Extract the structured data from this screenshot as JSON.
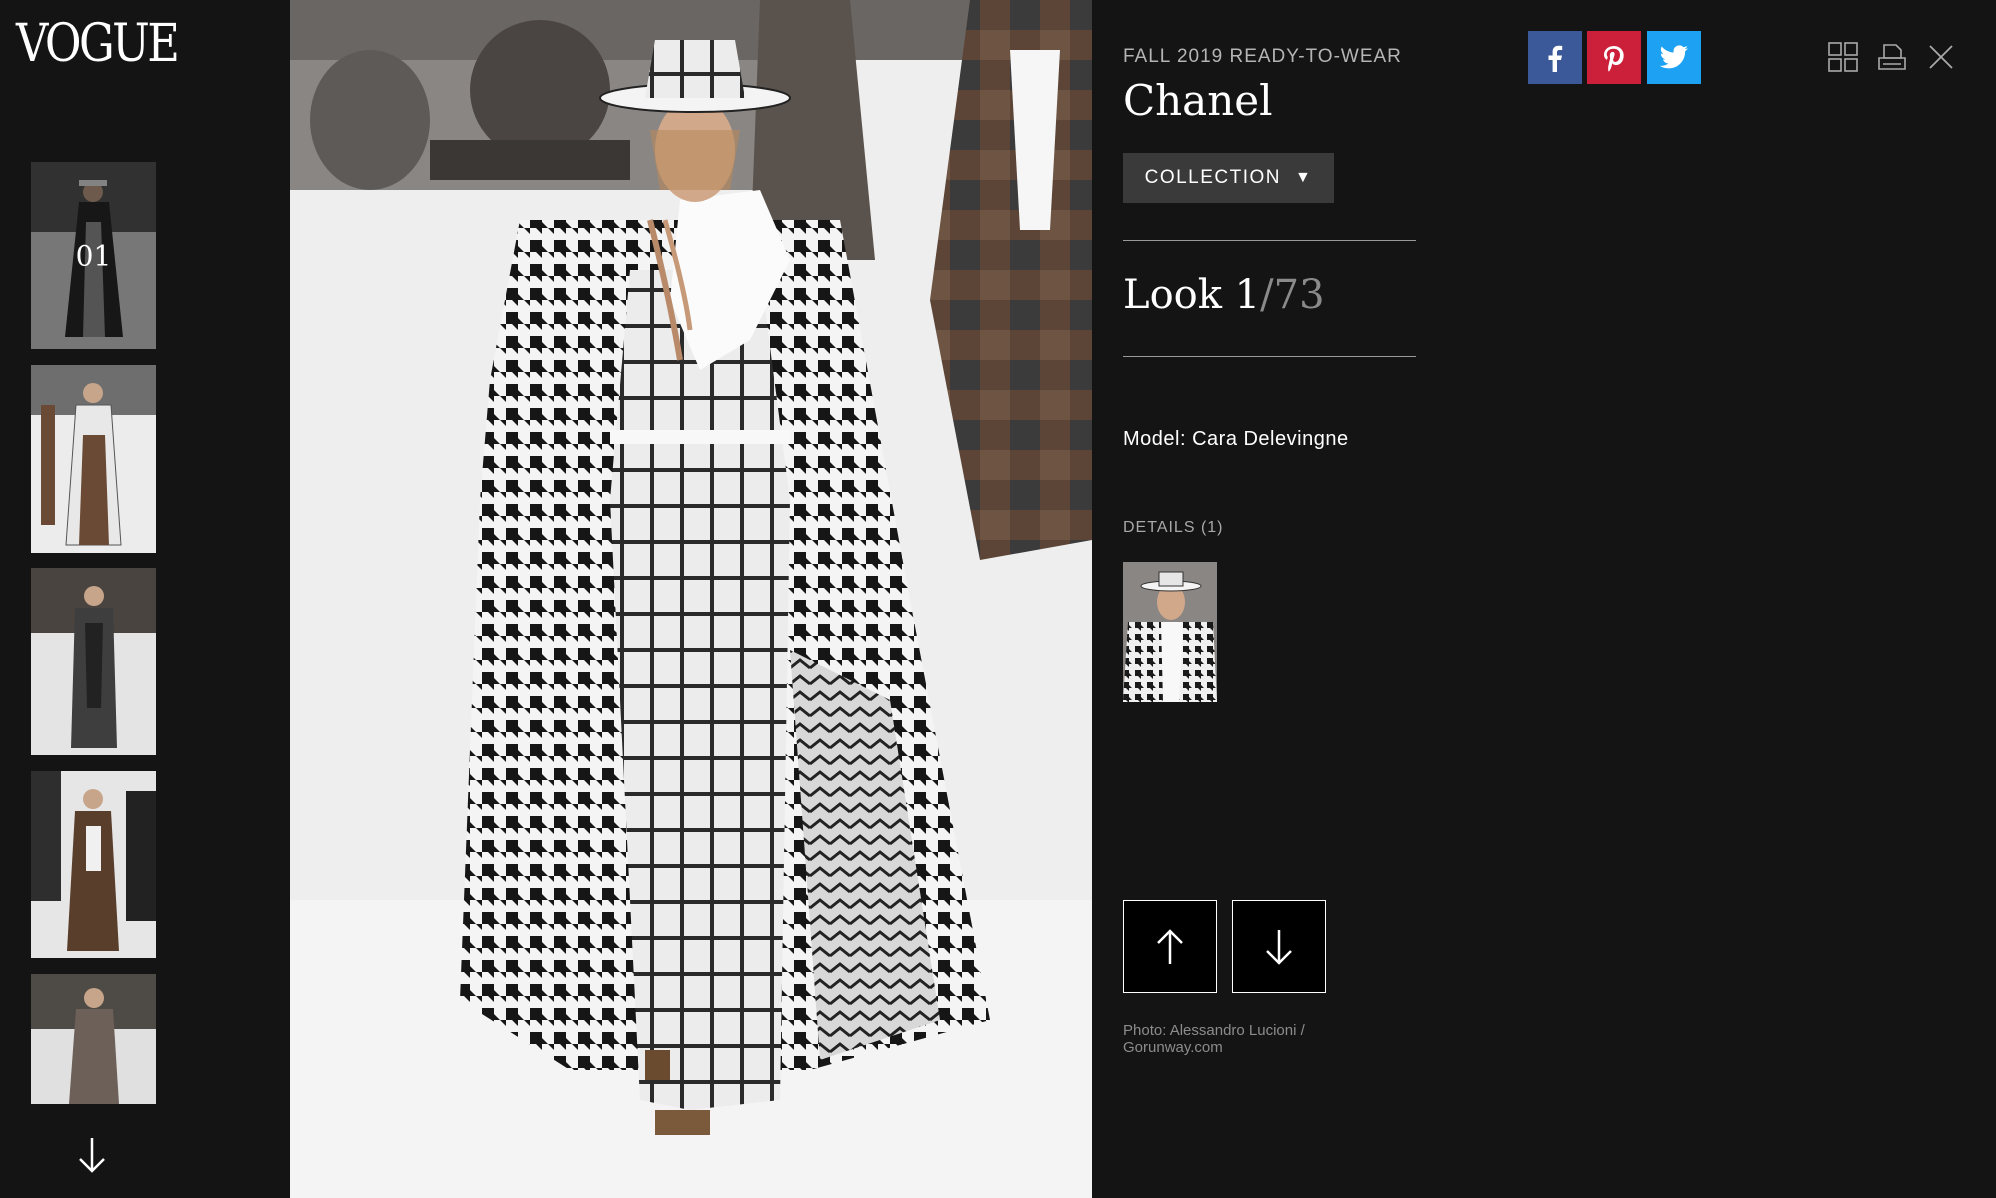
{
  "brand": {
    "logo_text": "VOGUE"
  },
  "sidebar": {
    "thumbnails": [
      {
        "label": "01",
        "active": true
      },
      {
        "label": "",
        "active": false
      },
      {
        "label": "",
        "active": false
      },
      {
        "label": "",
        "active": false
      },
      {
        "label": "",
        "active": false
      }
    ],
    "scroll_down_icon": "arrow-down-icon"
  },
  "show": {
    "season": "FALL 2019 READY-TO-WEAR",
    "designer": "Chanel",
    "collection_button": "COLLECTION",
    "collection_caret": "▼"
  },
  "look": {
    "prefix": "Look 1",
    "total": "/73"
  },
  "model": "Model: Cara Delevingne",
  "details": {
    "label": "DETAILS (1)"
  },
  "credit": "Photo: Alessandro Lucioni / Gorunway.com",
  "social": [
    {
      "name": "facebook",
      "glyph": "f",
      "color": "#3b5998"
    },
    {
      "name": "pinterest",
      "glyph": "P",
      "color": "#cb1f3a"
    },
    {
      "name": "twitter",
      "glyph": "t",
      "color": "#1da1f2"
    }
  ],
  "toolbar": {
    "grid_icon": "grid-icon",
    "print_icon": "print-icon",
    "close_icon": "close-icon"
  },
  "nav": {
    "up_icon": "arrow-up-icon",
    "down_icon": "arrow-down-icon"
  }
}
